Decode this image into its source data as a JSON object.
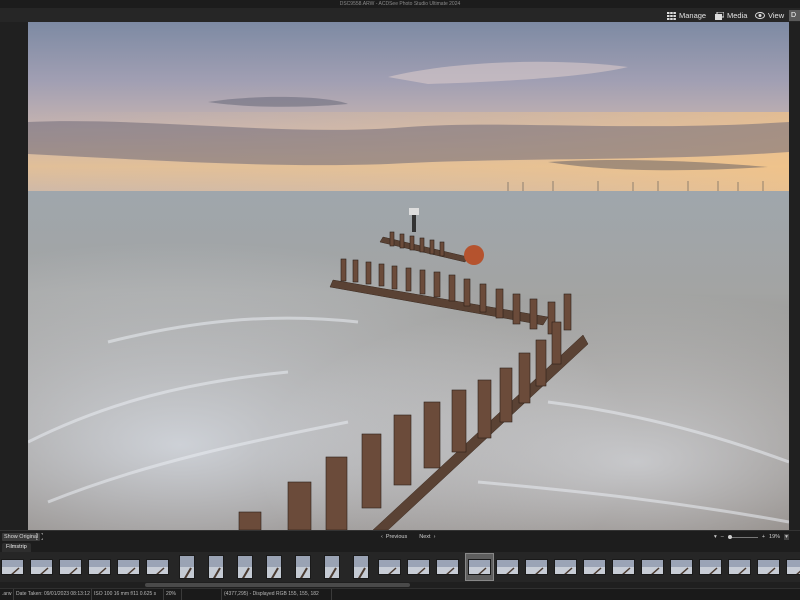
{
  "window": {
    "title": "DSC9558.ARW - ACDSee Photo Studio Ultimate 2024"
  },
  "modes": {
    "manage": "Manage",
    "media": "Media",
    "view": "View",
    "develop_partial": "D"
  },
  "viewer": {
    "show_original": "Show Original",
    "previous": "Previous",
    "next": "Next",
    "zoom": "19%"
  },
  "tabs": {
    "filmstrip": "Filmstrip"
  },
  "filmstrip": {
    "selected_index": 16,
    "thumb_count": 28
  },
  "status": {
    "filename_tail": ".arw",
    "date_taken": "Date Taken: 09/01/2023 08:13:12",
    "exif": "ISO 100 16 mm f/11 0.625 s",
    "zoom": "20%",
    "pixel_info": "(4377,295) - Displayed RGB 155, 155, 182"
  },
  "colors": {
    "accent": "#5a5a5a",
    "panel": "#262626",
    "status": "#1a1a1a"
  }
}
